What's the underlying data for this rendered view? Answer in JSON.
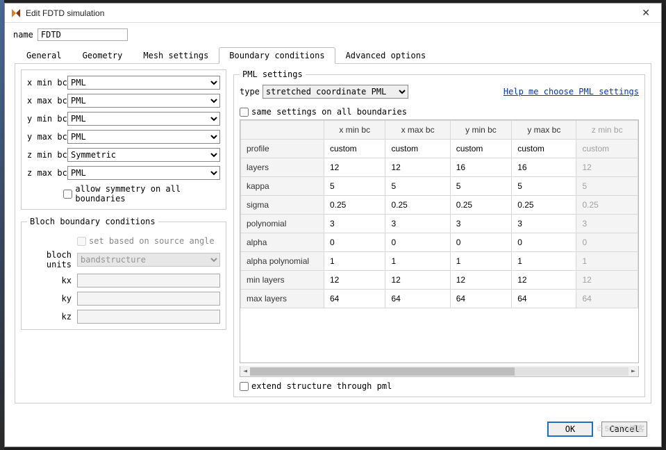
{
  "title": "Edit FDTD simulation",
  "name_label": "name",
  "name_value": "FDTD",
  "tabs": {
    "general": "General",
    "geometry": "Geometry",
    "mesh": "Mesh settings",
    "boundary": "Boundary conditions",
    "advanced": "Advanced options"
  },
  "bc": {
    "xmin_label": "x min bc",
    "xmin_value": "PML",
    "xmax_label": "x max bc",
    "xmax_value": "PML",
    "ymin_label": "y min bc",
    "ymin_value": "PML",
    "ymax_label": "y max bc",
    "ymax_value": "PML",
    "zmin_label": "z min bc",
    "zmin_value": "Symmetric",
    "zmax_label": "z max bc",
    "zmax_value": "PML",
    "allow_sym": "allow symmetry on all boundaries"
  },
  "bloch": {
    "legend": "Bloch boundary conditions",
    "set_based": "set based on source angle",
    "units_label": "bloch units",
    "units_value": "bandstructure",
    "kx_label": "kx",
    "kx_value": "",
    "ky_label": "ky",
    "ky_value": "",
    "kz_label": "kz",
    "kz_value": ""
  },
  "pml": {
    "legend": "PML settings",
    "type_label": "type",
    "type_value": "stretched coordinate PML",
    "help": "Help me choose PML settings",
    "same": "same settings on all boundaries",
    "extend": "extend structure through pml",
    "columns": [
      "x min bc",
      "x max bc",
      "y min bc",
      "y max bc",
      "z min bc"
    ],
    "rows": [
      {
        "name": "profile",
        "vals": [
          "custom",
          "custom",
          "custom",
          "custom",
          "custom"
        ]
      },
      {
        "name": "layers",
        "vals": [
          "12",
          "12",
          "16",
          "16",
          "12"
        ]
      },
      {
        "name": "kappa",
        "vals": [
          "5",
          "5",
          "5",
          "5",
          "5"
        ]
      },
      {
        "name": "sigma",
        "vals": [
          "0.25",
          "0.25",
          "0.25",
          "0.25",
          "0.25"
        ]
      },
      {
        "name": "polynomial",
        "vals": [
          "3",
          "3",
          "3",
          "3",
          "3"
        ]
      },
      {
        "name": "alpha",
        "vals": [
          "0",
          "0",
          "0",
          "0",
          "0"
        ]
      },
      {
        "name": "alpha polynomial",
        "vals": [
          "1",
          "1",
          "1",
          "1",
          "1"
        ]
      },
      {
        "name": "min layers",
        "vals": [
          "12",
          "12",
          "12",
          "12",
          "12"
        ]
      },
      {
        "name": "max layers",
        "vals": [
          "64",
          "64",
          "64",
          "64",
          "64"
        ]
      }
    ]
  },
  "buttons": {
    "ok": "OK",
    "cancel": "Cancel"
  },
  "watermark": "© 51CTO博客"
}
